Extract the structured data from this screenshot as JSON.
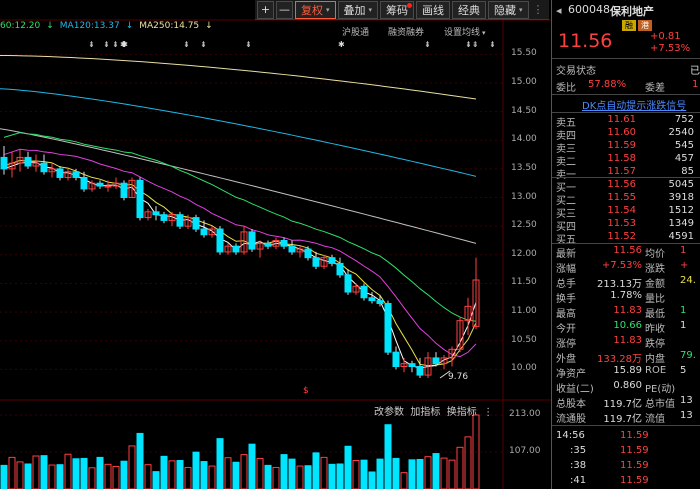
{
  "toolbar": {
    "plus": "+",
    "minus": "—",
    "fuquan": "复权",
    "diejia": "叠加",
    "choumа": "筹码",
    "huaxian": "画线",
    "jingdian": "经典",
    "yincang": "隐藏",
    "fuquan_caret": "▾",
    "diejia_caret": "▾",
    "yincang_caret": "▾",
    "handle": "⋮"
  },
  "ma_legend": {
    "ma60": "60:12.20",
    "arrow1": "↓",
    "ma120": "MA120:13.37",
    "arrow2": "↓",
    "ma250": "MA250:14.75",
    "arrow3": "↓"
  },
  "events": {
    "hgt": "沪股通",
    "rzrq": "融资融券",
    "szjx": "设置均线",
    "szjx_caret": "▾"
  },
  "markers": [
    {
      "t": "⇟"
    },
    {
      "t": "⇟"
    },
    {
      "t": "⇟ ✱"
    },
    {
      "t": "✱"
    },
    {
      "t": "⇟"
    },
    {
      "t": "⇟"
    },
    {
      "t": "⇟"
    },
    {
      "t": "✱"
    },
    {
      "t": "⇟"
    },
    {
      "t": "⇟⇟"
    },
    {
      "t": "⇟"
    }
  ],
  "price_axis": [
    "15.50",
    "15.00",
    "14.50",
    "14.00",
    "13.50",
    "13.00",
    "12.50",
    "12.00",
    "11.50",
    "11.00",
    "10.50",
    "10.00"
  ],
  "vol_axis": [
    "213.00",
    "107.00"
  ],
  "chart_annot": {
    "low": "9.76",
    "dollar": "$"
  },
  "vol_tools": {
    "gai": "改参数",
    "jia": "加指标",
    "huan": "换指标",
    "more": "⋮"
  },
  "colors": {
    "up": "#ff4040",
    "down": "#00e5ff",
    "ma5": "#ffffff",
    "ma10": "#e8e04a",
    "ma20": "#e040e0",
    "ma60": "#2ee06a",
    "ma120": "#20b8e8",
    "ma250": "#e8e0a0"
  },
  "chart_data": {
    "type": "candlestick",
    "ylim": [
      9.5,
      15.75
    ],
    "ohlc": [
      [
        13.7,
        13.9,
        13.4,
        13.5
      ],
      [
        13.5,
        13.8,
        13.35,
        13.6
      ],
      [
        13.6,
        13.85,
        13.45,
        13.7
      ],
      [
        13.7,
        13.8,
        13.5,
        13.55
      ],
      [
        13.55,
        13.75,
        13.45,
        13.6
      ],
      [
        13.6,
        13.75,
        13.4,
        13.45
      ],
      [
        13.45,
        13.6,
        13.35,
        13.5
      ],
      [
        13.5,
        13.55,
        13.3,
        13.35
      ],
      [
        13.35,
        13.5,
        13.3,
        13.45
      ],
      [
        13.45,
        13.5,
        13.3,
        13.35
      ],
      [
        13.35,
        13.45,
        13.1,
        13.15
      ],
      [
        13.15,
        13.3,
        13.1,
        13.25
      ],
      [
        13.25,
        13.3,
        13.15,
        13.2
      ],
      [
        13.2,
        13.3,
        13.1,
        13.2
      ],
      [
        13.2,
        13.35,
        13.15,
        13.25
      ],
      [
        13.25,
        13.3,
        12.95,
        13.0
      ],
      [
        13.0,
        13.35,
        13.0,
        13.3
      ],
      [
        13.3,
        13.35,
        12.6,
        12.65
      ],
      [
        12.65,
        12.8,
        12.6,
        12.75
      ],
      [
        12.75,
        12.85,
        12.6,
        12.7
      ],
      [
        12.7,
        12.75,
        12.55,
        12.6
      ],
      [
        12.6,
        12.75,
        12.5,
        12.7
      ],
      [
        12.7,
        12.75,
        12.45,
        12.5
      ],
      [
        12.5,
        12.7,
        12.45,
        12.65
      ],
      [
        12.65,
        12.7,
        12.4,
        12.45
      ],
      [
        12.45,
        12.6,
        12.3,
        12.35
      ],
      [
        12.35,
        12.5,
        12.3,
        12.45
      ],
      [
        12.45,
        12.5,
        12.0,
        12.05
      ],
      [
        12.05,
        12.2,
        12.0,
        12.15
      ],
      [
        12.15,
        12.2,
        12.0,
        12.05
      ],
      [
        12.05,
        12.5,
        12.0,
        12.4
      ],
      [
        12.4,
        12.45,
        12.05,
        12.1
      ],
      [
        12.1,
        12.25,
        11.95,
        12.2
      ],
      [
        12.2,
        12.25,
        12.1,
        12.15
      ],
      [
        12.15,
        12.3,
        12.1,
        12.25
      ],
      [
        12.25,
        12.3,
        12.1,
        12.15
      ],
      [
        12.15,
        12.25,
        12.0,
        12.05
      ],
      [
        12.05,
        12.15,
        11.95,
        12.1
      ],
      [
        12.1,
        12.15,
        11.9,
        11.95
      ],
      [
        11.95,
        12.05,
        11.75,
        11.8
      ],
      [
        11.8,
        12.0,
        11.75,
        11.95
      ],
      [
        11.95,
        12.0,
        11.8,
        11.85
      ],
      [
        11.85,
        11.95,
        11.6,
        11.65
      ],
      [
        11.65,
        11.75,
        11.3,
        11.35
      ],
      [
        11.35,
        11.5,
        11.3,
        11.45
      ],
      [
        11.45,
        11.5,
        11.2,
        11.25
      ],
      [
        11.25,
        11.35,
        11.15,
        11.2
      ],
      [
        11.2,
        11.3,
        11.1,
        11.15
      ],
      [
        11.15,
        11.2,
        10.25,
        10.3
      ],
      [
        10.3,
        10.4,
        10.0,
        10.05
      ],
      [
        10.05,
        10.2,
        9.95,
        10.1
      ],
      [
        10.1,
        10.15,
        9.95,
        10.05
      ],
      [
        10.05,
        10.2,
        9.85,
        9.9
      ],
      [
        9.9,
        10.3,
        9.85,
        10.2
      ],
      [
        10.2,
        10.3,
        10.05,
        10.1
      ],
      [
        10.1,
        10.25,
        10.0,
        10.2
      ],
      [
        10.2,
        10.4,
        10.05,
        10.35
      ],
      [
        10.35,
        10.9,
        10.3,
        10.85
      ],
      [
        10.85,
        11.25,
        10.6,
        11.1
      ],
      [
        10.75,
        11.95,
        10.7,
        11.56
      ]
    ],
    "volume_ylim": [
      0,
      213
    ]
  },
  "panel": {
    "back": "◂",
    "code": "600048",
    "name": "保利地产",
    "tag1": "融",
    "tag2": "港",
    "price": "11.56",
    "chg": "+0.81",
    "pct": "+7.53%",
    "trade_status": "交易状态",
    "trade_status_val": "已",
    "weibi_lbl": "委比",
    "weibi": "57.88%",
    "weicha_lbl": "委差",
    "weicha": "1",
    "dk": "DK点自动提示涨跌信号",
    "asks": [
      {
        "l": "卖五",
        "p": "11.61",
        "v": "752"
      },
      {
        "l": "卖四",
        "p": "11.60",
        "v": "2540"
      },
      {
        "l": "卖三",
        "p": "11.59",
        "v": "545"
      },
      {
        "l": "卖二",
        "p": "11.58",
        "v": "457"
      },
      {
        "l": "卖一",
        "p": "11.57",
        "v": "85"
      }
    ],
    "bids": [
      {
        "l": "买一",
        "p": "11.56",
        "v": "5045"
      },
      {
        "l": "买二",
        "p": "11.55",
        "v": "3918"
      },
      {
        "l": "买三",
        "p": "11.54",
        "v": "1512"
      },
      {
        "l": "买四",
        "p": "11.53",
        "v": "1349"
      },
      {
        "l": "买五",
        "p": "11.52",
        "v": "4591"
      }
    ],
    "stats": [
      {
        "l1": "最新",
        "v1": "11.56",
        "c1": "r",
        "l2": "均价",
        "v2": "1",
        "c2": "r"
      },
      {
        "l1": "涨幅",
        "v1": "+7.53%",
        "c1": "r",
        "l2": "涨跌",
        "v2": "+",
        "c2": "r"
      },
      {
        "l1": "总手",
        "v1": "213.13万",
        "c1": "w",
        "l2": "金额",
        "v2": "24.",
        "c2": "y"
      },
      {
        "l1": "换手",
        "v1": "1.78%",
        "c1": "w",
        "l2": "量比",
        "v2": "",
        "c2": "w"
      },
      {
        "l1": "最高",
        "v1": "11.83",
        "c1": "r",
        "l2": "最低",
        "v2": "1",
        "c2": "g"
      },
      {
        "l1": "今开",
        "v1": "10.66",
        "c1": "g",
        "l2": "昨收",
        "v2": "1",
        "c2": "w"
      },
      {
        "l1": "涨停",
        "v1": "11.83",
        "c1": "r",
        "l2": "跌停",
        "v2": "",
        "c2": "g"
      },
      {
        "l1": "外盘",
        "v1": "133.28万",
        "c1": "r",
        "l2": "内盘",
        "v2": "79.",
        "c2": "g"
      },
      {
        "l1": "净资产",
        "v1": "15.89",
        "c1": "w",
        "l2": "ROE",
        "v2": "5",
        "c2": "w"
      },
      {
        "l1": "收益(二)",
        "v1": "0.860",
        "c1": "w",
        "l2": "PE(动)",
        "v2": "",
        "c2": "w"
      },
      {
        "l1": "总股本",
        "v1": "119.7亿",
        "c1": "w",
        "l2": "总市值",
        "v2": "13",
        "c2": "w"
      },
      {
        "l1": "流通股",
        "v1": "119.7亿",
        "c1": "w",
        "l2": "流值",
        "v2": "13",
        "c2": "w"
      }
    ],
    "ticks": [
      {
        "t": "14:56",
        "p": "11.59"
      },
      {
        "t": ":35",
        "p": "11.59"
      },
      {
        "t": ":38",
        "p": "11.59"
      },
      {
        "t": ":41",
        "p": "11.59"
      }
    ]
  }
}
